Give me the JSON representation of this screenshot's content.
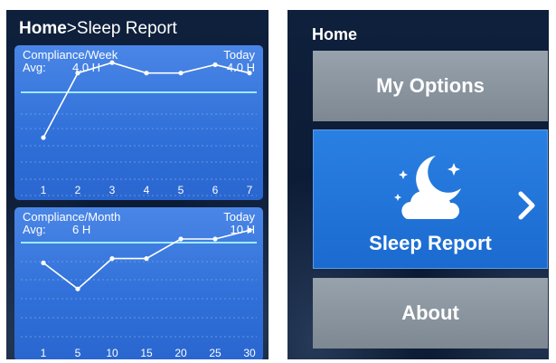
{
  "left_screen": {
    "title": {
      "home": "Home",
      "sep": ">",
      "page": "Sleep Report"
    },
    "panels": [
      {
        "id": "week",
        "title": "Compliance/Week",
        "today_label": "Today",
        "avg_label": "Avg:",
        "avg_value": "4.0  H",
        "today_value": "4.0  H",
        "x_labels": [
          "1",
          "2",
          "3",
          "4",
          "5",
          "6",
          "7"
        ],
        "values": [
          2.0,
          5.1,
          5.6,
          5.1,
          5.1,
          5.5,
          5.1
        ]
      },
      {
        "id": "month",
        "title": "Compliance/Month",
        "today_label": "Today",
        "avg_label": "Avg:",
        "avg_value": "6  H",
        "today_value": "10  H",
        "x_labels": [
          "1",
          "5",
          "10",
          "15",
          "20",
          "25",
          "30"
        ],
        "values": [
          4.4,
          3.2,
          4.6,
          4.6,
          5.5,
          5.5,
          5.9
        ]
      }
    ]
  },
  "right_screen": {
    "title": "Home",
    "menu": [
      {
        "label": "My Options"
      },
      {
        "label": "Sleep Report"
      },
      {
        "label": "About"
      }
    ],
    "colors": {
      "selected": "#1f73d8",
      "unselected": "#8a949e"
    },
    "icons": {
      "sleep": "moon-cloud-stars-icon",
      "next": "chevron-right-icon"
    }
  }
}
